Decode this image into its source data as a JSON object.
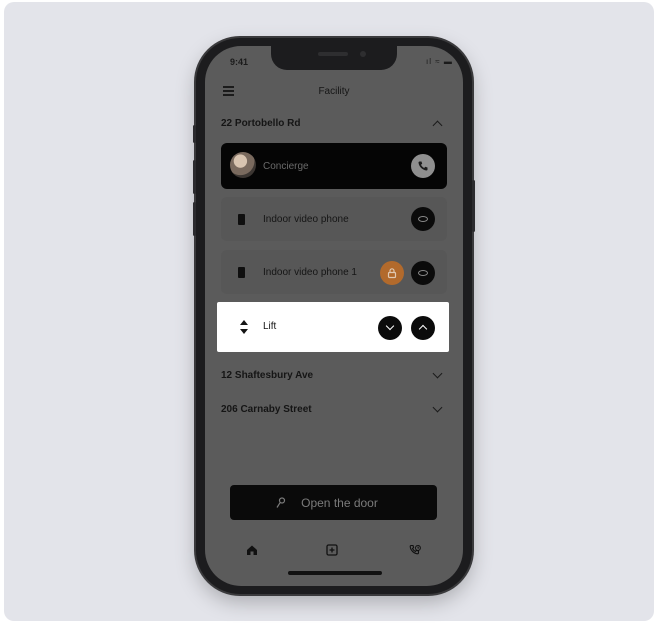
{
  "status_bar": {
    "time": "9:41",
    "icons_text": "ıl ≈ ▬"
  },
  "header": {
    "title": "Facility"
  },
  "groups": [
    {
      "title": "22 Portobello Rd",
      "expanded": true
    },
    {
      "title": "12 Shaftesbury Ave",
      "expanded": false
    },
    {
      "title": "206 Carnaby Street",
      "expanded": false
    }
  ],
  "concierge": {
    "label": "Concierge"
  },
  "devices": [
    {
      "label": "Indoor video phone"
    },
    {
      "label": "Indoor video phone 1"
    }
  ],
  "lift": {
    "label": "Lift"
  },
  "open_door": {
    "label": "Open the door"
  },
  "bottom_nav": [
    "home-icon",
    "add-icon",
    "call-history-icon"
  ],
  "colors": {
    "screen_dim": "#5b5b5b",
    "card": "#575757",
    "accent_lock": "#b26a2c",
    "button_dark": "#0b0b0b",
    "backdrop": "#e3e4ea"
  }
}
